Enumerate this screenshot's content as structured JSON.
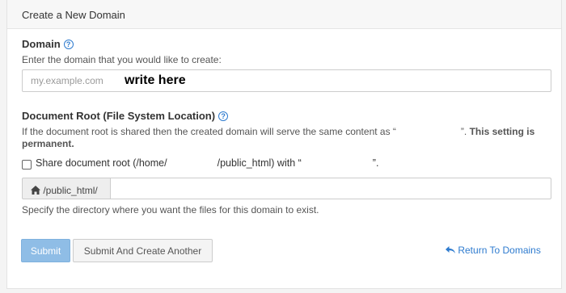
{
  "header": {
    "title": "Create a New Domain"
  },
  "domain": {
    "label": "Domain",
    "hint": "Enter the domain that you would like to create:",
    "placeholder": "my.example.com",
    "value": "",
    "overlay": "write here"
  },
  "docroot": {
    "label": "Document Root (File System Location)",
    "hint_prefix": "If the document root is shared then the created domain will serve the same content as “",
    "hint_suffix": "”. ",
    "hint_bold": "This setting is permanent.",
    "share_label_prefix": "Share document root (/home/",
    "share_label_middle": "/public_html) with “",
    "share_label_suffix": "”.",
    "share_checked": false,
    "addon_icon": "home-icon",
    "addon_text": "/public_html/",
    "path_value": "",
    "help_text": "Specify the directory where you want the files for this domain to exist."
  },
  "actions": {
    "submit": "Submit",
    "submit_another": "Submit And Create Another",
    "return_icon": "return-arrow-icon",
    "return_link": "Return To Domains"
  },
  "colors": {
    "accent": "#2e7bcf",
    "submit_bg": "#8fbde6"
  }
}
